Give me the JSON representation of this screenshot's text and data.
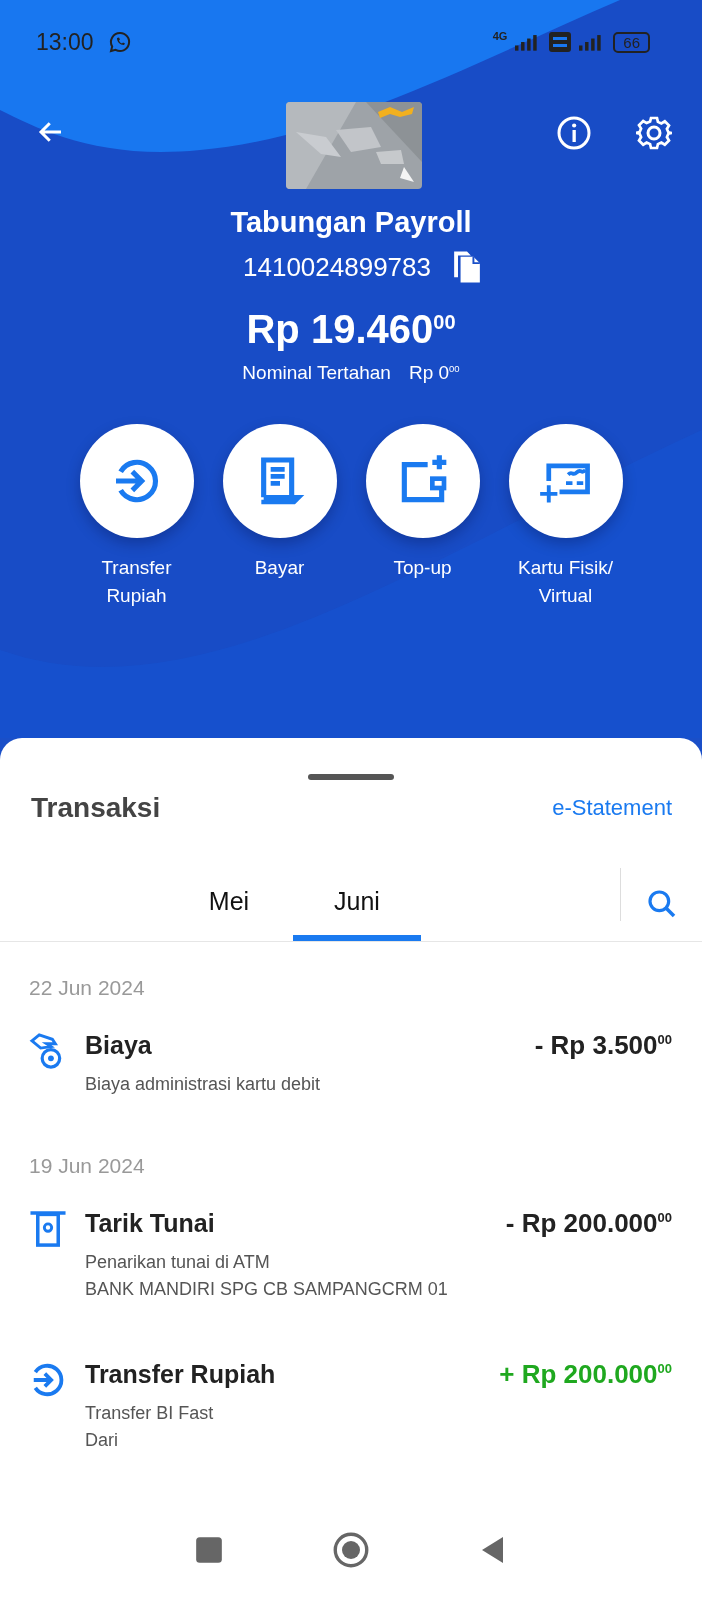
{
  "status_bar": {
    "time": "13:00",
    "network": "4G",
    "battery": "66"
  },
  "account": {
    "name": "Tabungan Payroll",
    "number": "1410024899783",
    "balance": "Rp 19.460$^{00}$",
    "held_label": "Nominal Tertahan",
    "held_amount": "Rp 0$^{00}$"
  },
  "actions": [
    {
      "label": "Transfer Rupiah"
    },
    {
      "label": "Bayar"
    },
    {
      "label": "Top-up"
    },
    {
      "label": "Kartu Fisik/ Virtual"
    }
  ],
  "transactions": {
    "title": "Transaksi",
    "statement_link": "e-Statement",
    "tabs": [
      {
        "label": "Mei",
        "selected": false
      },
      {
        "label": "Juni",
        "selected": true
      }
    ],
    "groups": [
      {
        "date": "22 Jun 2024",
        "items": [
          {
            "kind": "fee",
            "title": "Biaya",
            "amount": "- Rp 3.500$^{00}$",
            "credit": false,
            "details": [
              "Biaya administrasi kartu debit"
            ]
          }
        ]
      },
      {
        "date": "19 Jun 2024",
        "items": [
          {
            "kind": "withdrawal",
            "title": "Tarik Tunai",
            "amount": "- Rp 200.000$^{00}$",
            "credit": false,
            "details": [
              "Penarikan tunai di ATM",
              "BANK MANDIRI SPG CB SAMPANGCRM 01"
            ]
          },
          {
            "kind": "transfer",
            "title": "Transfer Rupiah",
            "amount": "+ Rp 200.000$^{00}$",
            "credit": true,
            "details": [
              "Transfer BI Fast",
              "Dari"
            ]
          }
        ]
      }
    ]
  }
}
